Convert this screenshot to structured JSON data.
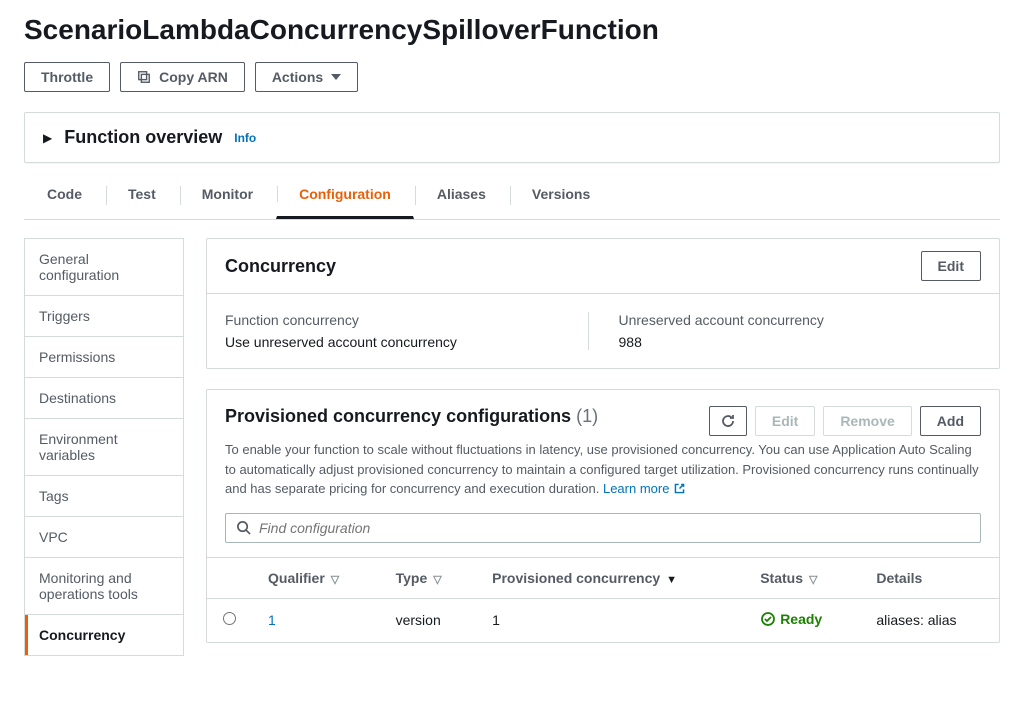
{
  "page_title": "ScenarioLambdaConcurrencySpilloverFunction",
  "top_buttons": {
    "throttle": "Throttle",
    "copy_arn": "Copy ARN",
    "actions": "Actions"
  },
  "overview": {
    "title": "Function overview",
    "info": "Info"
  },
  "tabs": [
    "Code",
    "Test",
    "Monitor",
    "Configuration",
    "Aliases",
    "Versions"
  ],
  "sidebar_items": [
    "General configuration",
    "Triggers",
    "Permissions",
    "Destinations",
    "Environment variables",
    "Tags",
    "VPC",
    "Monitoring and operations tools",
    "Concurrency"
  ],
  "concurrency_card": {
    "title": "Concurrency",
    "edit": "Edit",
    "function_concurrency_label": "Function concurrency",
    "function_concurrency_value": "Use unreserved account concurrency",
    "unreserved_label": "Unreserved account concurrency",
    "unreserved_value": "988"
  },
  "provisioned_card": {
    "title": "Provisioned concurrency configurations",
    "count": "(1)",
    "edit": "Edit",
    "remove": "Remove",
    "add": "Add",
    "description": "To enable your function to scale without fluctuations in latency, use provisioned concurrency. You can use Application Auto Scaling to automatically adjust provisioned concurrency to maintain a configured target utilization. Provisioned concurrency runs continually and has separate pricing for concurrency and execution duration.",
    "learn_more": "Learn more",
    "search_placeholder": "Find configuration",
    "columns": {
      "qualifier": "Qualifier",
      "type": "Type",
      "provisioned": "Provisioned concurrency",
      "status": "Status",
      "details": "Details"
    },
    "row": {
      "qualifier": "1",
      "type": "version",
      "provisioned": "1",
      "status": "Ready",
      "details": "aliases: alias"
    }
  }
}
